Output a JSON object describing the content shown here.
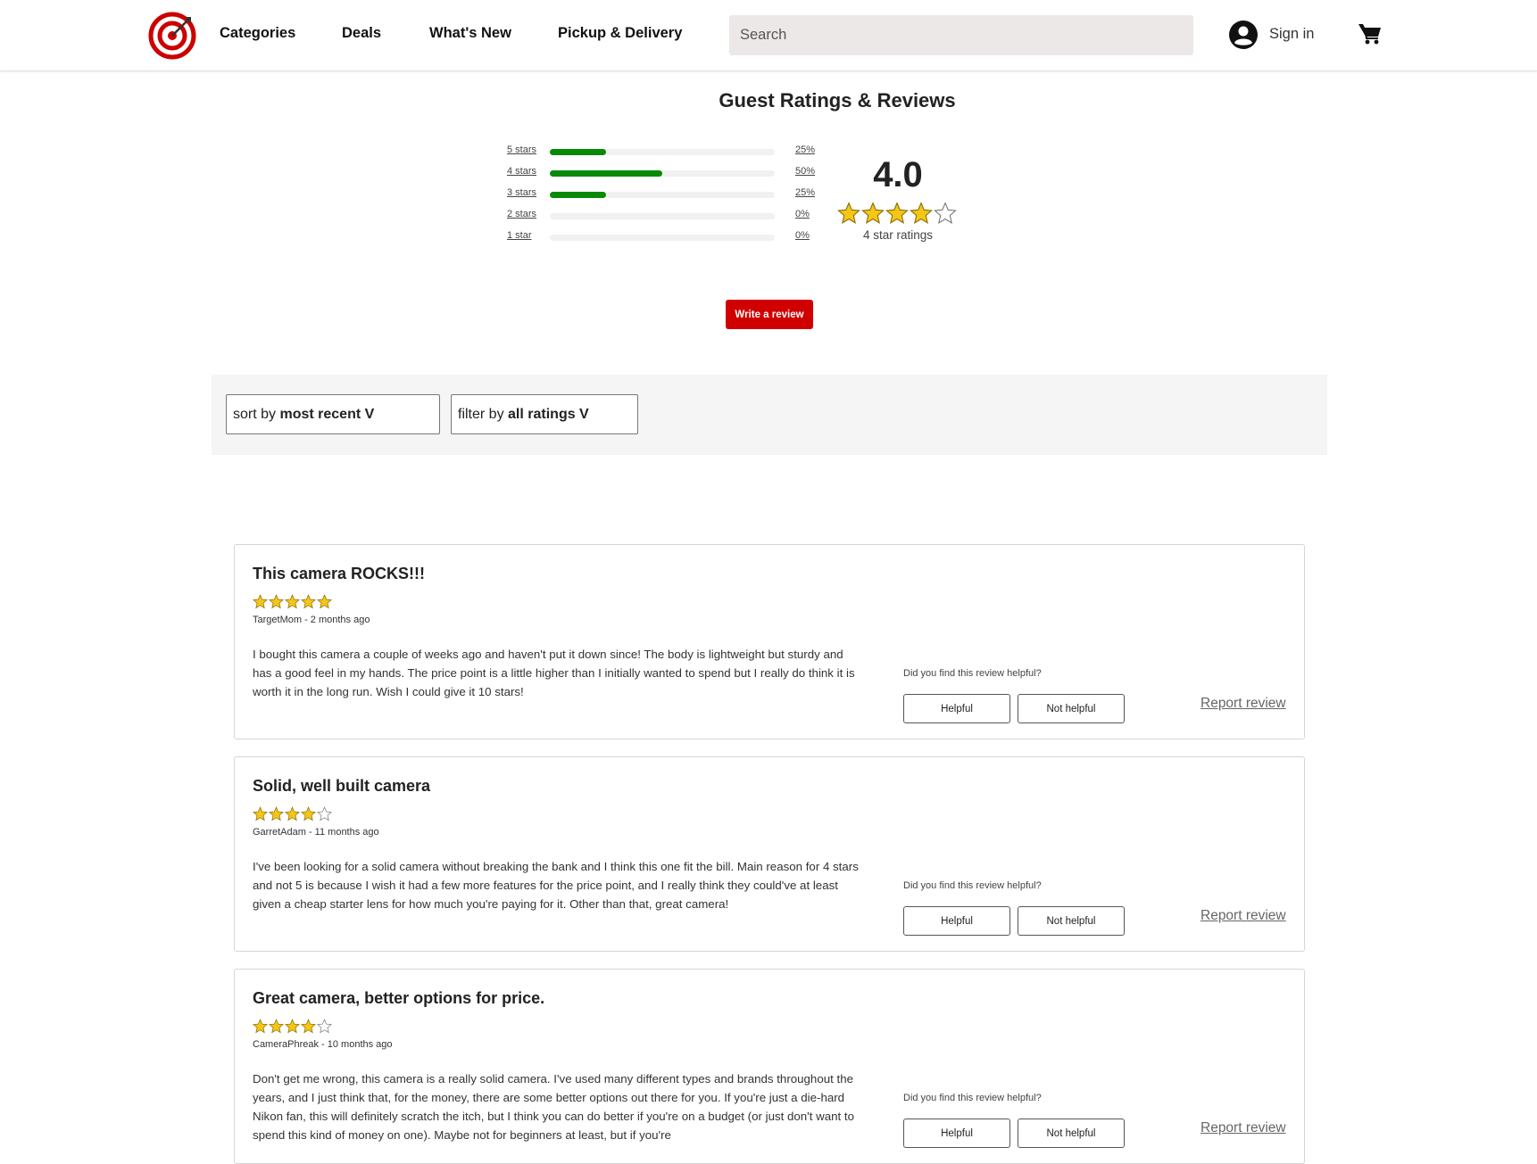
{
  "header": {
    "nav": [
      "Categories",
      "Deals",
      "What's New",
      "Pickup & Delivery"
    ],
    "search_placeholder": "Search",
    "sign_in": "Sign in",
    "logo_icon": "target-logo-icon",
    "account_icon": "account-icon",
    "cart_icon": "cart-icon"
  },
  "ratings": {
    "title": "Guest Ratings & Reviews",
    "distribution": [
      {
        "label": "5 stars",
        "percent_text": "25%",
        "fraction": 0.25
      },
      {
        "label": "4 stars",
        "percent_text": "50%",
        "fraction": 0.5
      },
      {
        "label": "3 stars",
        "percent_text": "25%",
        "fraction": 0.25
      },
      {
        "label": "2 stars",
        "percent_text": "0%",
        "fraction": 0
      },
      {
        "label": "1 star",
        "percent_text": "0%",
        "fraction": 0
      }
    ],
    "average": "4.0",
    "average_stars": 4,
    "count_text": "4 star ratings",
    "write_review": "Write a review",
    "bar_color": "#078a07",
    "star_color": "#f5c518"
  },
  "filters": {
    "sort_prefix": "sort by",
    "sort_value": "most recent V",
    "filter_prefix": "filter by",
    "filter_value": "all ratings V"
  },
  "reviews": [
    {
      "title": "This camera ROCKS!!!",
      "stars": 5,
      "meta": "TargetMom - 2 months ago",
      "body": "I bought this camera a couple of weeks ago and haven't put it down since! The body is lightweight but sturdy and has a good feel in my hands. The price point is a little higher than I initially wanted to spend but I really do think it is worth it in the long run. Wish I could give it 10 stars!",
      "helpful_question": "Did you find this review helpful?",
      "helpful": "Helpful",
      "not_helpful": "Not helpful",
      "report": "Report review"
    },
    {
      "title": "Solid, well built camera",
      "stars": 4,
      "meta": "GarretAdam - 11 months ago",
      "body": "I've been looking for a solid camera without breaking the bank and I think this one fit the bill. Main reason for 4 stars and not 5 is because I wish it had a few more features for the price point, and I really think they could've at least given a cheap starter lens for how much you're paying for it. Other than that, great camera!",
      "helpful_question": "Did you find this review helpful?",
      "helpful": "Helpful",
      "not_helpful": "Not helpful",
      "report": "Report review"
    },
    {
      "title": "Great camera, better options for price.",
      "stars": 4,
      "meta": "CameraPhreak - 10 months ago",
      "body": "Don't get me wrong, this camera is a really solid camera. I've used many different types and brands throughout the years, and I just think that, for the money, there are some better options out there for you. If you're just a die-hard Nikon fan, this will definitely scratch the itch, but I think you can do better if you're on a budget (or just don't want to spend this kind of money on one). Maybe not for beginners at least, but if you're",
      "helpful_question": "Did you find this review helpful?",
      "helpful": "Helpful",
      "not_helpful": "Not helpful",
      "report": "Report review"
    }
  ]
}
